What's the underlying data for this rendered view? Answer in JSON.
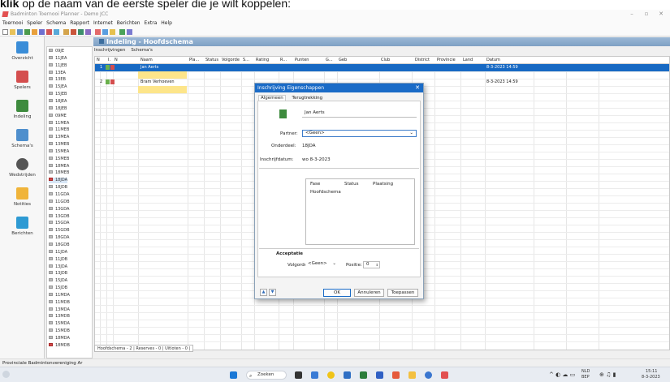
{
  "doc_caption_bold": "klik",
  "doc_caption_rest": " op de naam van de eerste speler die je wilt koppelen:",
  "window": {
    "title": "Badminton Toernooi Planner - Demo JCC"
  },
  "menu": [
    "Toernooi",
    "Speler",
    "Schema",
    "Rapport",
    "Internet",
    "Berichten",
    "Extra",
    "Help"
  ],
  "sidebar": [
    {
      "label": "Overzicht",
      "icon": "overview-icon",
      "color": "#3a8dd8"
    },
    {
      "label": "Spelers",
      "icon": "players-icon",
      "color": "#d44e4e"
    },
    {
      "label": "Indeling",
      "icon": "grouping-icon",
      "color": "#3e8b3e"
    },
    {
      "label": "Schema's",
      "icon": "schema-icon",
      "color": "#4f8fcd"
    },
    {
      "label": "Wedstrijden",
      "icon": "shuttlecock-icon",
      "color": "#555555"
    },
    {
      "label": "Notities",
      "icon": "notes-icon",
      "color": "#f0b43a"
    },
    {
      "label": "Berichten",
      "icon": "messages-icon",
      "color": "#2e9ad3"
    }
  ],
  "main_header": "Indeling - Hoofdschema",
  "tree_items": [
    "09JE",
    "11JEA",
    "11JEB",
    "13EA",
    "13EB",
    "15JEA",
    "15JEB",
    "18JEA",
    "18JEB",
    "09ME",
    "11MEA",
    "11MEB",
    "13MEA",
    "13MEB",
    "15MEA",
    "15MEB",
    "18MEA",
    "18MEB",
    "18JDA",
    "18JDB",
    "11GDA",
    "11GDB",
    "13GDA",
    "13GDB",
    "15GDA",
    "15GDB",
    "18GDA",
    "18GDB",
    "11JDA",
    "11JDB",
    "13JDA",
    "13JDB",
    "15JDA",
    "15JDB",
    "11MDA",
    "11MDB",
    "13MDA",
    "13MDB",
    "15MDA",
    "15MDB",
    "18MDA",
    "18MDB"
  ],
  "tree_selected": "18JDA",
  "tabs": [
    "Inschrijvingen",
    "Schema's"
  ],
  "columns": [
    "N",
    "I.",
    "N",
    "Naam",
    "Pla...",
    "Status",
    "Volgorde",
    "S...",
    "Rating",
    "R...",
    "Punten",
    "G...",
    "Geb",
    "Club",
    "District",
    "Provincie",
    "Land",
    "Datum"
  ],
  "rows": [
    {
      "nr": "1",
      "naam": "Jan Aerts",
      "datum": "8-3-2023 14:59"
    },
    {
      "nr": "2",
      "naam": "Bram Verhoeven",
      "datum": "8-3-2023 14:59"
    }
  ],
  "bottom_tabs": "Hoofdschema - 2 | Reserves - 0 | Uitloten - 0 |",
  "status_bar": "Provinciale Badmintonvereniging Ar",
  "dialog": {
    "title": "Inschrijving Eigenschappen",
    "tabs": [
      "Algemeen",
      "Terugtrekking"
    ],
    "player_name": "Jan Aerts",
    "partner_label": "Partner:",
    "partner_value": "<Geen>",
    "onderdeel_label": "Onderdeel:",
    "onderdeel_value": "18JDA",
    "inschrijfdatum_label": "Inschrijfdatum:",
    "inschrijfdatum_value": "wo 8-3-2023",
    "fase_headers": [
      "Fase",
      "Status",
      "Plaatsing"
    ],
    "fase_rows": [
      "Hoofdschema"
    ],
    "acceptatie_label": "Acceptatie",
    "volgorde_label": "Volgorde:",
    "volgorde_value": "<Geen>",
    "positie_label": "Positie:",
    "positie_value": "0",
    "ok_label": "OK",
    "cancel_label": "Annuleren",
    "apply_label": "Toepassen"
  },
  "taskbar": {
    "search_label": "Zoeken",
    "lang_top": "NLD",
    "lang_bottom": "BEP",
    "time": "15:11",
    "date": "8-3-2023"
  }
}
